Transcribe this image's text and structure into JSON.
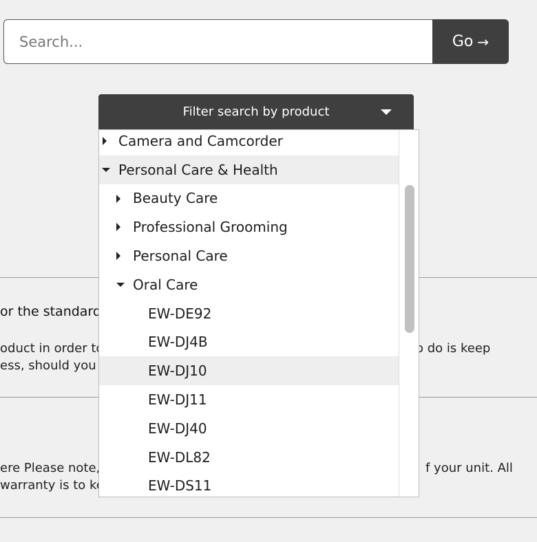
{
  "search": {
    "placeholder": "Search...",
    "go_label": "Go",
    "go_arrow": "→"
  },
  "filter": {
    "label": "Filter search by product"
  },
  "tree": {
    "rows": [
      {
        "label": "Camera and Camcorder",
        "level": 0,
        "state": "collapsed",
        "highlighted": false
      },
      {
        "label": "Personal Care & Health",
        "level": 0,
        "state": "expanded",
        "highlighted": true
      },
      {
        "label": "Beauty Care",
        "level": 1,
        "state": "collapsed",
        "highlighted": false
      },
      {
        "label": "Professional Grooming",
        "level": 1,
        "state": "collapsed",
        "highlighted": false
      },
      {
        "label": "Personal Care",
        "level": 1,
        "state": "collapsed",
        "highlighted": false
      },
      {
        "label": "Oral Care",
        "level": 1,
        "state": "expanded",
        "highlighted": false
      },
      {
        "label": "EW-DE92",
        "level": 2,
        "state": "leaf",
        "highlighted": false
      },
      {
        "label": "EW-DJ4B",
        "level": 2,
        "state": "leaf",
        "highlighted": false
      },
      {
        "label": "EW-DJ10",
        "level": 2,
        "state": "leaf",
        "highlighted": true
      },
      {
        "label": "EW-DJ11",
        "level": 2,
        "state": "leaf",
        "highlighted": false
      },
      {
        "label": "EW-DJ40",
        "level": 2,
        "state": "leaf",
        "highlighted": false
      },
      {
        "label": "EW-DL82",
        "level": 2,
        "state": "leaf",
        "highlighted": false
      },
      {
        "label": "EW-DS11",
        "level": 2,
        "state": "leaf",
        "highlighted": false
      }
    ]
  },
  "background": {
    "heading_fragment": "or the standard",
    "para1_line1_left": "oduct in order to",
    "para1_line1_right": "o do is keep",
    "para1_line2_left": "ess, should you w",
    "para2_line1_left": "ere Please note, t",
    "para2_line1_right": "f your unit. All",
    "para2_line2_left": "warranty is to  ke"
  }
}
